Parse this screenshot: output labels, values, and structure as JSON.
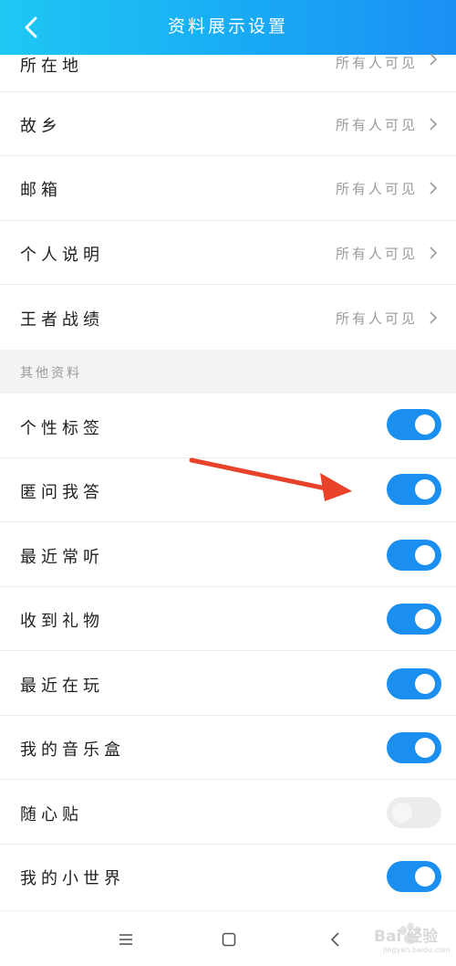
{
  "header": {
    "title": "资料展示设置"
  },
  "visibility_items": [
    {
      "label": "所在地",
      "value": "所有人可见"
    },
    {
      "label": "故乡",
      "value": "所有人可见"
    },
    {
      "label": "邮箱",
      "value": "所有人可见"
    },
    {
      "label": "个人说明",
      "value": "所有人可见"
    },
    {
      "label": "王者战绩",
      "value": "所有人可见"
    }
  ],
  "section": {
    "title": "其他资料"
  },
  "toggle_items": [
    {
      "label": "个性标签",
      "enabled": true
    },
    {
      "label": "匿问我答",
      "enabled": true
    },
    {
      "label": "最近常听",
      "enabled": true
    },
    {
      "label": "收到礼物",
      "enabled": true
    },
    {
      "label": "最近在玩",
      "enabled": true
    },
    {
      "label": "我的音乐盒",
      "enabled": true
    },
    {
      "label": "随心贴",
      "enabled": false
    },
    {
      "label": "我的小世界",
      "enabled": true
    }
  ],
  "icons": {
    "back": "chevron-left-icon",
    "row_chevron": "chevron-right-icon",
    "nav_menu": "menu-icon",
    "nav_home": "square-home-icon",
    "nav_back": "chevron-left-icon",
    "annotation": "red-arrow-icon"
  },
  "colors": {
    "header_gradient_start": "#1ec8f3",
    "header_gradient_end": "#1a8ff3",
    "toggle_on": "#1b8ff0",
    "toggle_off": "#ececec",
    "annotation_arrow": "#e8432a"
  },
  "watermark": {
    "brand": "Bai 经验",
    "url": "jingyan.baidu.com"
  }
}
